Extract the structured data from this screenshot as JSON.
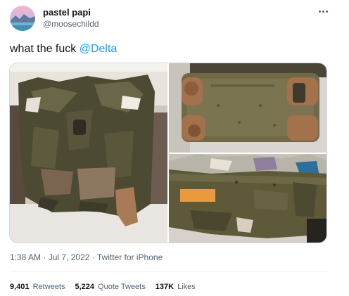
{
  "author": {
    "display_name": "pastel papi",
    "handle": "@moosechildd",
    "avatar_icon": "landscape-avatar-icon"
  },
  "more_icon": "more-horizontal-icon",
  "tweet": {
    "text_prefix": "what the fuck ",
    "mention": "@Delta"
  },
  "media": {
    "photos": [
      {
        "name": "destroyed-suitcase-front"
      },
      {
        "name": "damaged-suitcase-bottom"
      },
      {
        "name": "ripped-suitcase-top"
      }
    ]
  },
  "meta": {
    "time": "1:38 AM",
    "separator": " · ",
    "date": "Jul 7, 2022",
    "source": "Twitter for iPhone"
  },
  "stats": {
    "retweets_count": "9,401",
    "retweets_label": "Retweets",
    "quotes_count": "5,224",
    "quotes_label": "Quote Tweets",
    "likes_count": "137K",
    "likes_label": "Likes"
  },
  "colors": {
    "accent": "#1d9bf0",
    "text": "#0f1419",
    "muted": "#536471"
  }
}
